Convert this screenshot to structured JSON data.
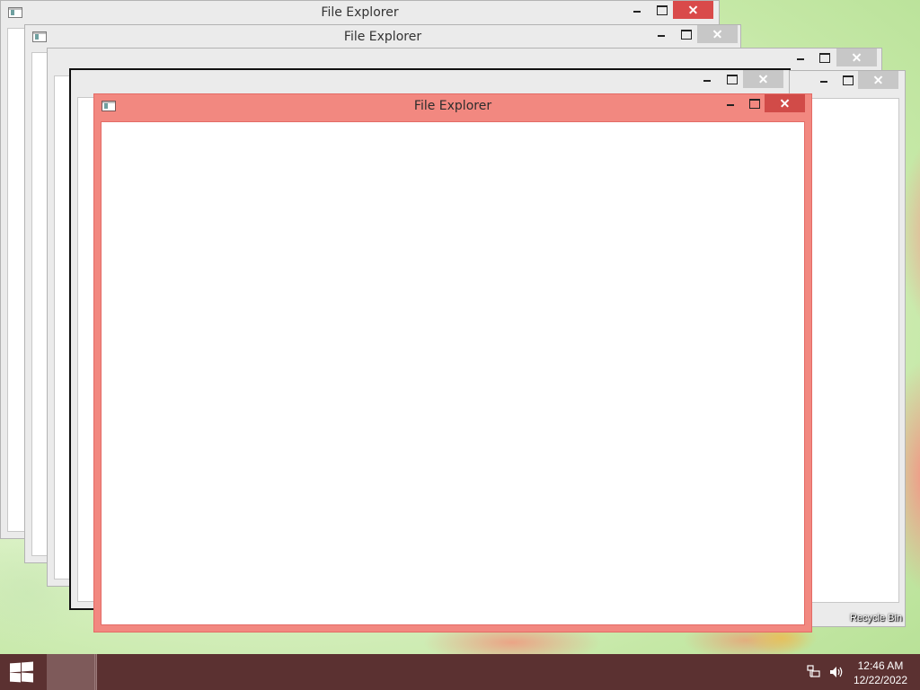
{
  "windows": {
    "w1": {
      "title": "File Explorer"
    },
    "w2": {
      "title": "File Explorer"
    },
    "w3": {
      "title": ""
    },
    "w4": {
      "title": ""
    },
    "w5": {
      "title": ""
    },
    "active": {
      "title": "File Explorer"
    }
  },
  "desktop": {
    "icons": [
      {
        "label": "Recycle Bin"
      }
    ]
  },
  "taskbar": {
    "start_icon": "windows-logo",
    "tray": {
      "network_icon": "network-icon",
      "volume_icon": "volume-icon",
      "time": "12:46 AM",
      "date": "12/22/2022"
    }
  },
  "colors": {
    "active_frame": "#f28880",
    "close_active": "#d14b48",
    "taskbar": "#5b3131"
  }
}
